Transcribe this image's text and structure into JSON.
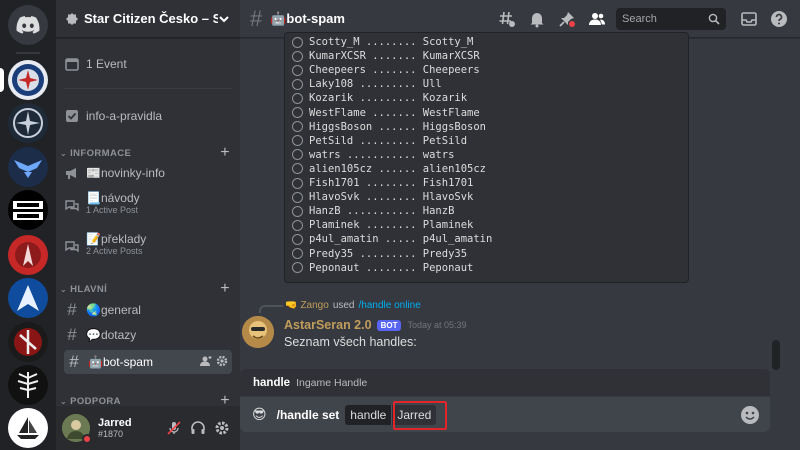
{
  "guild": {
    "name": "Star Citizen Česko – S..."
  },
  "sidebar": {
    "event": "1 Event",
    "rules_channel": "info-a-pravidla",
    "categories": [
      {
        "label": "INFORMACE",
        "channels": [
          {
            "label": "📰novinky-info",
            "sub": ""
          },
          {
            "label": "📃návody",
            "sub": "1 Active Post"
          },
          {
            "label": "📝překlady",
            "sub": "2 Active Posts"
          }
        ]
      },
      {
        "label": "HLAVNÍ",
        "channels": [
          {
            "label": "🌏general"
          },
          {
            "label": "💬dotazy"
          },
          {
            "label": "🤖bot-spam"
          }
        ]
      },
      {
        "label": "PODPORA"
      }
    ]
  },
  "user": {
    "name": "Jarred",
    "tag": "#1870"
  },
  "channel": {
    "title": "🤖bot-spam"
  },
  "search": {
    "placeholder": "Search"
  },
  "codeblock": {
    "rows": [
      "Scotty_M ........ Scotty_M",
      "KumarXCSR ....... KumarXCSR",
      "Cheepeers ....... Cheepeers",
      "Laky108 ......... Ull",
      "Kozarik ......... Kozarik",
      "WestFlame ....... WestFlame",
      "HiggsBoson ...... HiggsBoson",
      "PetSild ......... PetSild",
      "watrs ........... watrs",
      "alien105cz ...... alien105cz",
      "Fish1701 ........ Fish1701",
      "HlavoSvk ........ HlavoSvk",
      "HanzB ........... HanzB",
      "Plaminek ........ Plaminek",
      "p4ul_amatin ..... p4ul_amatin",
      "Predy35 ......... Predy35",
      "Peponaut ........ Peponaut"
    ]
  },
  "reply": {
    "emoji": "🤜",
    "user": "Zango",
    "used": "used",
    "command": "/handle online"
  },
  "message": {
    "author": "AstarSeran 2.0",
    "badge": "BOT",
    "timestamp": "Today at 05:39",
    "text": "Seznam všech handles:"
  },
  "autocomplete": {
    "name": "handle",
    "description": "Ingame Handle"
  },
  "composer": {
    "emoji": "😎",
    "command": "/handle set",
    "option_name": "handle",
    "option_value": "Jarred"
  },
  "colors": {
    "accent": "#5865f2",
    "highlight": "#e0262a",
    "author": "#c09d5a",
    "link": "#00aff4"
  }
}
